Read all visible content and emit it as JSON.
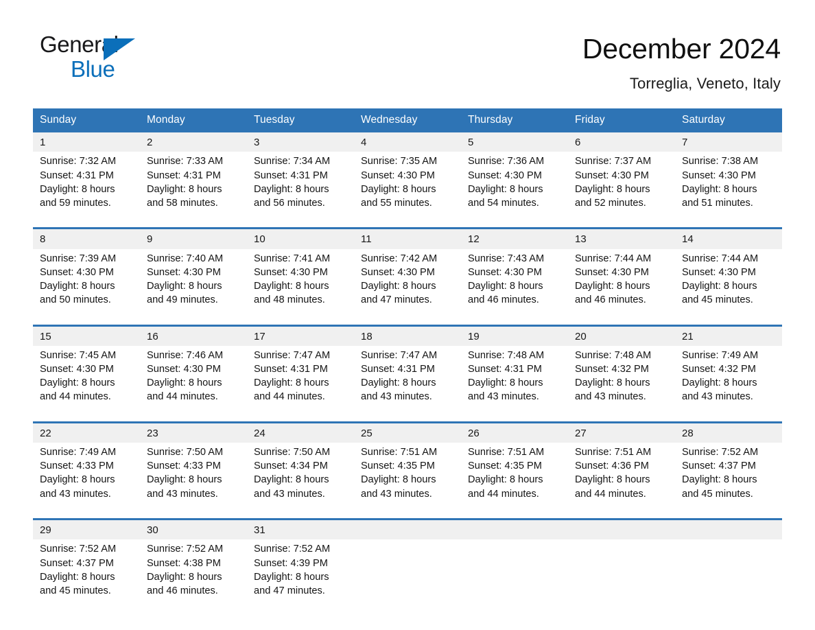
{
  "brand": {
    "name_part1": "General",
    "name_part2": "Blue",
    "accent_color": "#0b6fba",
    "triangle_icon": "triangle-icon"
  },
  "header": {
    "month_title": "December 2024",
    "location": "Torreglia, Veneto, Italy"
  },
  "theme": {
    "header_blue": "#2e74b5",
    "date_strip_gray": "#f0f0f0"
  },
  "weekday_headers": [
    "Sunday",
    "Monday",
    "Tuesday",
    "Wednesday",
    "Thursday",
    "Friday",
    "Saturday"
  ],
  "weeks": [
    {
      "dates": [
        "1",
        "2",
        "3",
        "4",
        "5",
        "6",
        "7"
      ],
      "cells": [
        {
          "sunrise": "Sunrise: 7:32 AM",
          "sunset": "Sunset: 4:31 PM",
          "daylight1": "Daylight: 8 hours",
          "daylight2": "and 59 minutes."
        },
        {
          "sunrise": "Sunrise: 7:33 AM",
          "sunset": "Sunset: 4:31 PM",
          "daylight1": "Daylight: 8 hours",
          "daylight2": "and 58 minutes."
        },
        {
          "sunrise": "Sunrise: 7:34 AM",
          "sunset": "Sunset: 4:31 PM",
          "daylight1": "Daylight: 8 hours",
          "daylight2": "and 56 minutes."
        },
        {
          "sunrise": "Sunrise: 7:35 AM",
          "sunset": "Sunset: 4:30 PM",
          "daylight1": "Daylight: 8 hours",
          "daylight2": "and 55 minutes."
        },
        {
          "sunrise": "Sunrise: 7:36 AM",
          "sunset": "Sunset: 4:30 PM",
          "daylight1": "Daylight: 8 hours",
          "daylight2": "and 54 minutes."
        },
        {
          "sunrise": "Sunrise: 7:37 AM",
          "sunset": "Sunset: 4:30 PM",
          "daylight1": "Daylight: 8 hours",
          "daylight2": "and 52 minutes."
        },
        {
          "sunrise": "Sunrise: 7:38 AM",
          "sunset": "Sunset: 4:30 PM",
          "daylight1": "Daylight: 8 hours",
          "daylight2": "and 51 minutes."
        }
      ]
    },
    {
      "dates": [
        "8",
        "9",
        "10",
        "11",
        "12",
        "13",
        "14"
      ],
      "cells": [
        {
          "sunrise": "Sunrise: 7:39 AM",
          "sunset": "Sunset: 4:30 PM",
          "daylight1": "Daylight: 8 hours",
          "daylight2": "and 50 minutes."
        },
        {
          "sunrise": "Sunrise: 7:40 AM",
          "sunset": "Sunset: 4:30 PM",
          "daylight1": "Daylight: 8 hours",
          "daylight2": "and 49 minutes."
        },
        {
          "sunrise": "Sunrise: 7:41 AM",
          "sunset": "Sunset: 4:30 PM",
          "daylight1": "Daylight: 8 hours",
          "daylight2": "and 48 minutes."
        },
        {
          "sunrise": "Sunrise: 7:42 AM",
          "sunset": "Sunset: 4:30 PM",
          "daylight1": "Daylight: 8 hours",
          "daylight2": "and 47 minutes."
        },
        {
          "sunrise": "Sunrise: 7:43 AM",
          "sunset": "Sunset: 4:30 PM",
          "daylight1": "Daylight: 8 hours",
          "daylight2": "and 46 minutes."
        },
        {
          "sunrise": "Sunrise: 7:44 AM",
          "sunset": "Sunset: 4:30 PM",
          "daylight1": "Daylight: 8 hours",
          "daylight2": "and 46 minutes."
        },
        {
          "sunrise": "Sunrise: 7:44 AM",
          "sunset": "Sunset: 4:30 PM",
          "daylight1": "Daylight: 8 hours",
          "daylight2": "and 45 minutes."
        }
      ]
    },
    {
      "dates": [
        "15",
        "16",
        "17",
        "18",
        "19",
        "20",
        "21"
      ],
      "cells": [
        {
          "sunrise": "Sunrise: 7:45 AM",
          "sunset": "Sunset: 4:30 PM",
          "daylight1": "Daylight: 8 hours",
          "daylight2": "and 44 minutes."
        },
        {
          "sunrise": "Sunrise: 7:46 AM",
          "sunset": "Sunset: 4:30 PM",
          "daylight1": "Daylight: 8 hours",
          "daylight2": "and 44 minutes."
        },
        {
          "sunrise": "Sunrise: 7:47 AM",
          "sunset": "Sunset: 4:31 PM",
          "daylight1": "Daylight: 8 hours",
          "daylight2": "and 44 minutes."
        },
        {
          "sunrise": "Sunrise: 7:47 AM",
          "sunset": "Sunset: 4:31 PM",
          "daylight1": "Daylight: 8 hours",
          "daylight2": "and 43 minutes."
        },
        {
          "sunrise": "Sunrise: 7:48 AM",
          "sunset": "Sunset: 4:31 PM",
          "daylight1": "Daylight: 8 hours",
          "daylight2": "and 43 minutes."
        },
        {
          "sunrise": "Sunrise: 7:48 AM",
          "sunset": "Sunset: 4:32 PM",
          "daylight1": "Daylight: 8 hours",
          "daylight2": "and 43 minutes."
        },
        {
          "sunrise": "Sunrise: 7:49 AM",
          "sunset": "Sunset: 4:32 PM",
          "daylight1": "Daylight: 8 hours",
          "daylight2": "and 43 minutes."
        }
      ]
    },
    {
      "dates": [
        "22",
        "23",
        "24",
        "25",
        "26",
        "27",
        "28"
      ],
      "cells": [
        {
          "sunrise": "Sunrise: 7:49 AM",
          "sunset": "Sunset: 4:33 PM",
          "daylight1": "Daylight: 8 hours",
          "daylight2": "and 43 minutes."
        },
        {
          "sunrise": "Sunrise: 7:50 AM",
          "sunset": "Sunset: 4:33 PM",
          "daylight1": "Daylight: 8 hours",
          "daylight2": "and 43 minutes."
        },
        {
          "sunrise": "Sunrise: 7:50 AM",
          "sunset": "Sunset: 4:34 PM",
          "daylight1": "Daylight: 8 hours",
          "daylight2": "and 43 minutes."
        },
        {
          "sunrise": "Sunrise: 7:51 AM",
          "sunset": "Sunset: 4:35 PM",
          "daylight1": "Daylight: 8 hours",
          "daylight2": "and 43 minutes."
        },
        {
          "sunrise": "Sunrise: 7:51 AM",
          "sunset": "Sunset: 4:35 PM",
          "daylight1": "Daylight: 8 hours",
          "daylight2": "and 44 minutes."
        },
        {
          "sunrise": "Sunrise: 7:51 AM",
          "sunset": "Sunset: 4:36 PM",
          "daylight1": "Daylight: 8 hours",
          "daylight2": "and 44 minutes."
        },
        {
          "sunrise": "Sunrise: 7:52 AM",
          "sunset": "Sunset: 4:37 PM",
          "daylight1": "Daylight: 8 hours",
          "daylight2": "and 45 minutes."
        }
      ]
    },
    {
      "dates": [
        "29",
        "30",
        "31",
        "",
        "",
        "",
        ""
      ],
      "cells": [
        {
          "sunrise": "Sunrise: 7:52 AM",
          "sunset": "Sunset: 4:37 PM",
          "daylight1": "Daylight: 8 hours",
          "daylight2": "and 45 minutes."
        },
        {
          "sunrise": "Sunrise: 7:52 AM",
          "sunset": "Sunset: 4:38 PM",
          "daylight1": "Daylight: 8 hours",
          "daylight2": "and 46 minutes."
        },
        {
          "sunrise": "Sunrise: 7:52 AM",
          "sunset": "Sunset: 4:39 PM",
          "daylight1": "Daylight: 8 hours",
          "daylight2": "and 47 minutes."
        },
        {
          "sunrise": "",
          "sunset": "",
          "daylight1": "",
          "daylight2": ""
        },
        {
          "sunrise": "",
          "sunset": "",
          "daylight1": "",
          "daylight2": ""
        },
        {
          "sunrise": "",
          "sunset": "",
          "daylight1": "",
          "daylight2": ""
        },
        {
          "sunrise": "",
          "sunset": "",
          "daylight1": "",
          "daylight2": ""
        }
      ]
    }
  ]
}
